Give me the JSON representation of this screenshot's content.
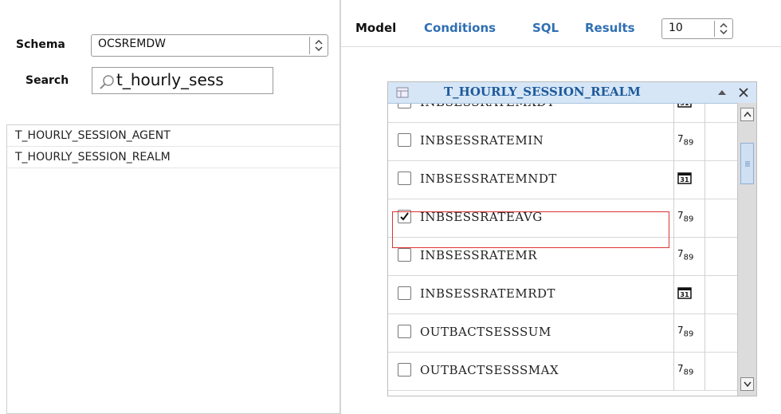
{
  "left": {
    "schema_label": "Schema",
    "schema_value": "OCSREMDW",
    "search_label": "Search",
    "search_value": "t_hourly_sess",
    "tables": [
      "T_HOURLY_SESSION_AGENT",
      "T_HOURLY_SESSION_REALM"
    ]
  },
  "right": {
    "tabs": {
      "model": "Model",
      "conditions": "Conditions",
      "sql": "SQL",
      "results": "Results"
    },
    "results_count": "10"
  },
  "panel": {
    "title": "T_HOURLY_SESSION_REALM",
    "rows": [
      {
        "name": "INBSESSRATEMXDT",
        "checked": false,
        "type_icon": "calendar-icon"
      },
      {
        "name": "INBSESSRATEMIN",
        "checked": false,
        "type_icon": "numeric-icon"
      },
      {
        "name": "INBSESSRATEMNDT",
        "checked": false,
        "type_icon": "calendar-icon"
      },
      {
        "name": "INBSESSRATEAVG",
        "checked": true,
        "type_icon": "numeric-icon"
      },
      {
        "name": "INBSESSRATEMR",
        "checked": false,
        "type_icon": "numeric-icon"
      },
      {
        "name": "INBSESSRATEMRDT",
        "checked": false,
        "type_icon": "calendar-icon"
      },
      {
        "name": "OUTBACTSESSSUM",
        "checked": false,
        "type_icon": "numeric-icon"
      },
      {
        "name": "OUTBACTSESSSMAX",
        "checked": false,
        "type_icon": "numeric-icon"
      }
    ],
    "numeric_icon_text": {
      "big": "7",
      "small": "89"
    },
    "calendar_icon_text": "31"
  },
  "colors": {
    "tab_link": "#2f6fb3",
    "panel_header": "#d6e6f7",
    "selection_border": "#dd3333"
  }
}
